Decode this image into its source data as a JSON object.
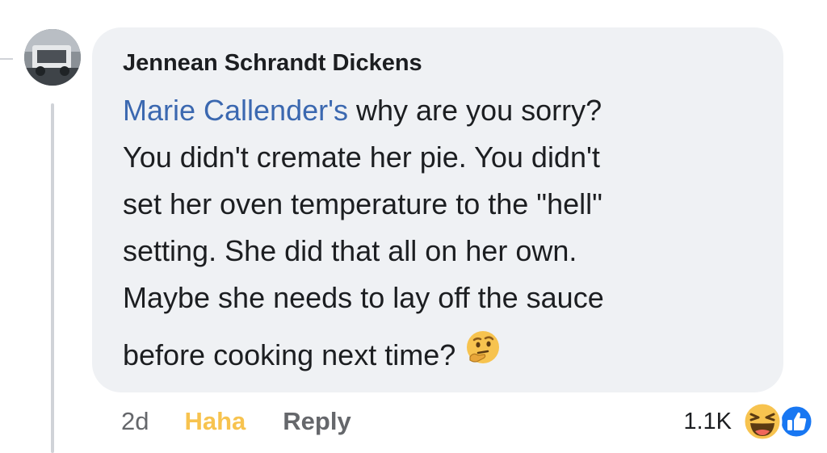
{
  "comment": {
    "author": "Jennean Schrandt Dickens",
    "mention": "Marie Callender's",
    "lines": [
      " why are you sorry?",
      "You didn't cremate her pie. You didn't",
      "set her oven temperature to the \"hell\"",
      "setting. She did that all on her own.",
      "Maybe she needs to lay off the sauce",
      "before cooking next time?"
    ],
    "trailing_emoji": "thinking-face-icon"
  },
  "actions": {
    "timestamp": "2d",
    "haha": "Haha",
    "reply": "Reply"
  },
  "reactions": {
    "count": "1.1K",
    "icons": [
      "haha-face-icon",
      "like-thumb-icon"
    ]
  },
  "colors": {
    "bubble_bg": "#eff1f4",
    "mention": "#3b68b0",
    "haha_active": "#f7c34f",
    "muted": "#65676b",
    "like_blue": "#1877f2"
  }
}
